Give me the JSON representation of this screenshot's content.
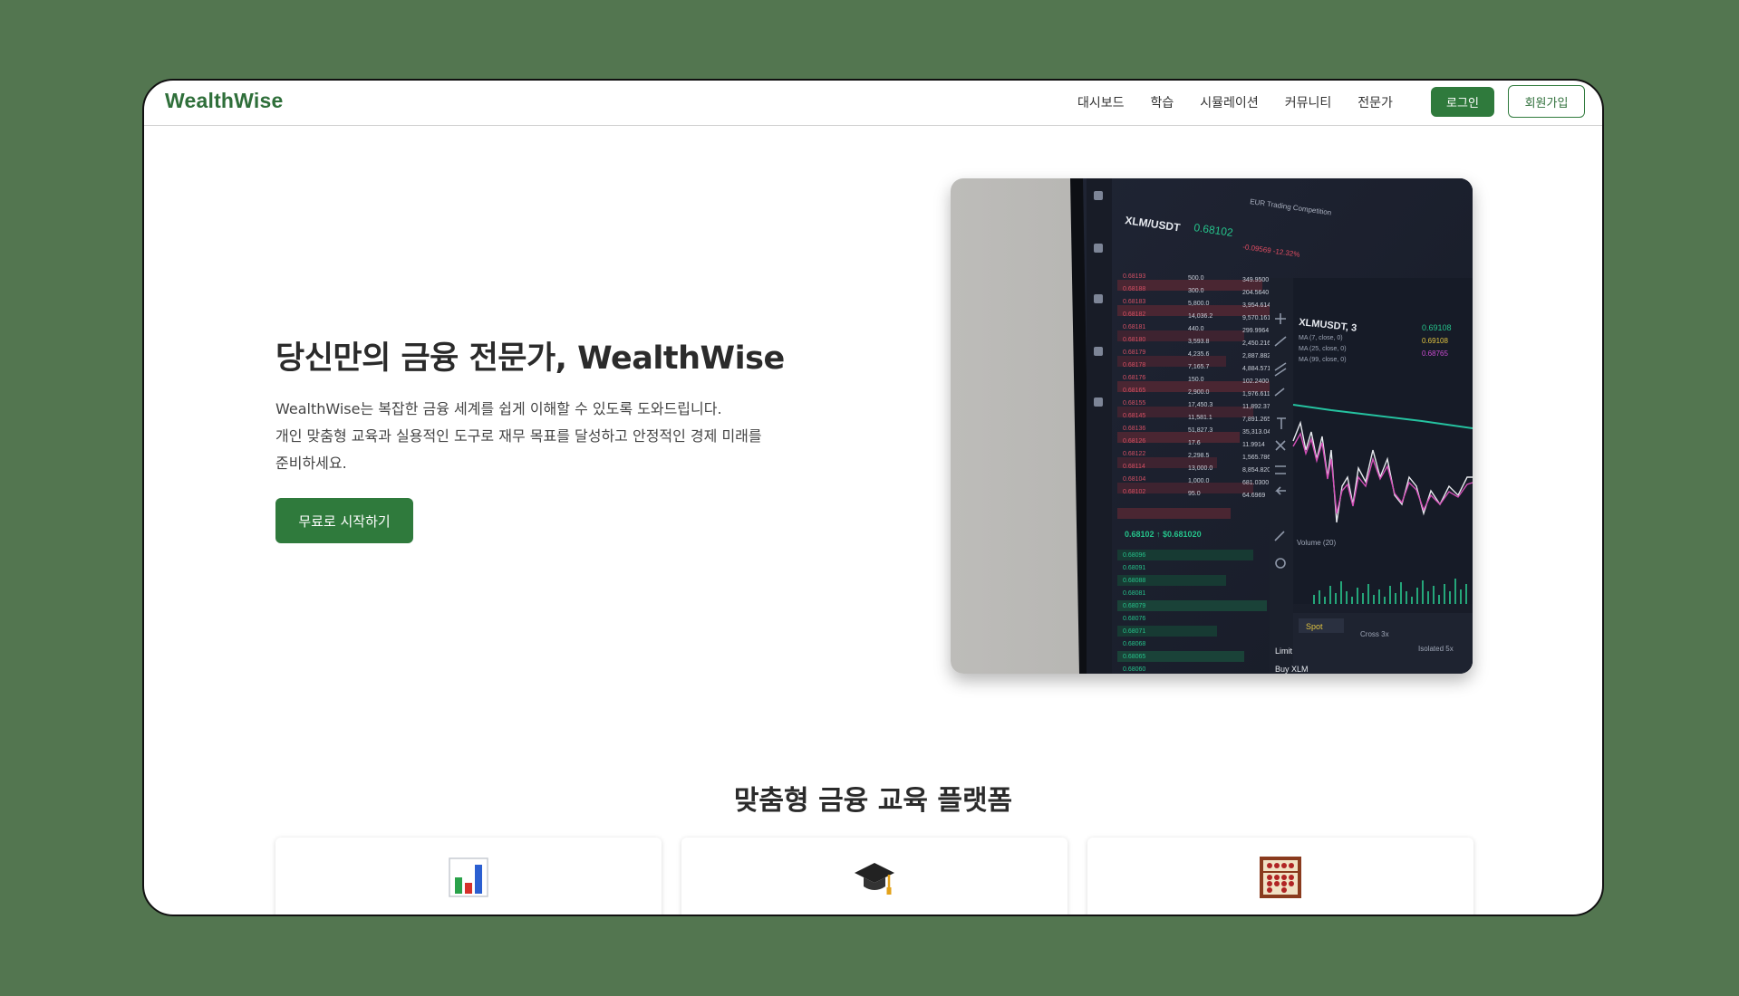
{
  "brand": {
    "logo": "WealthWise",
    "accent": "#2f7a3c",
    "background": "#537650"
  },
  "nav": {
    "links": [
      "대시보드",
      "학습",
      "시뮬레이션",
      "커뮤니티",
      "전문가"
    ],
    "login": "로그인",
    "signup": "회원가입"
  },
  "hero": {
    "title": "당신만의 금융 전문가, WealthWise",
    "description_lines": [
      "WealthWise는 복잡한 금융 세계를 쉽게 이해할 수 있도록 도와드립니다.",
      "개인 맞춤형 교육과 실용적인 도구로 재무 목표를 달성하고 안정적인 경제 미래를",
      "준비하세요."
    ],
    "cta": "무료로 시작하기",
    "image": {
      "pair": "XLM/USDT",
      "price": "0.68102",
      "change": "-0.09569 -12.32%",
      "header": "EUR Trading Competition",
      "chart_label": "XLMUSDT, 3",
      "volume": "Volume (20)",
      "spot": "Spot",
      "cross": "Cross 3x",
      "isolated": "Isolated 5x",
      "limit": "Limit",
      "buy": "Buy XLM"
    }
  },
  "features": {
    "title": "맞춤형 금융 교육 플랫폼",
    "cards": [
      {
        "icon": "bar-chart-icon"
      },
      {
        "icon": "graduation-cap-icon"
      },
      {
        "icon": "abacus-icon"
      }
    ]
  }
}
